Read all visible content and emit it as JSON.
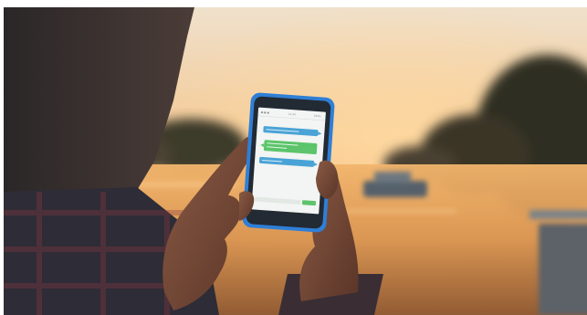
{
  "scene": {
    "description_tags": [
      "person",
      "smartphone",
      "chat-app",
      "sunset",
      "river",
      "bokeh"
    ],
    "colors": {
      "sky_top": "#f7e3c8",
      "sky_horizon": "#f3b86a",
      "water": "#e9a65e",
      "phone_case": "#2f7fd6",
      "chat_blue": "#4aa3d6",
      "chat_green": "#5cc46a",
      "screen_bg": "#f2f5f3"
    }
  },
  "phone": {
    "status_left": "● ● ●",
    "status_center": "12:34",
    "status_right": "100%",
    "messages": [
      {
        "side": "left",
        "color": "blue",
        "text": ""
      },
      {
        "side": "right",
        "color": "green",
        "text": ""
      },
      {
        "side": "left",
        "color": "blue",
        "text": ""
      }
    ]
  }
}
